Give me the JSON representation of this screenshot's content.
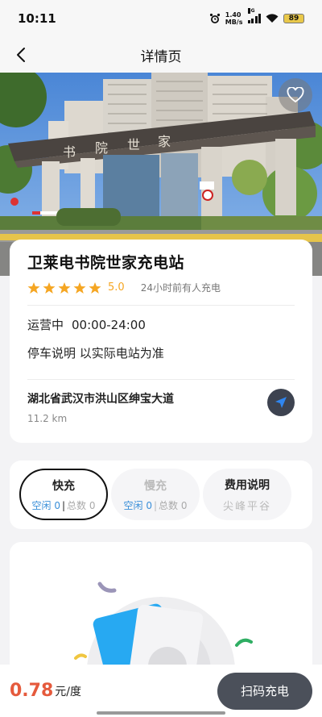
{
  "status_bar": {
    "time": "10:11",
    "net_speed_value": "1.40",
    "net_speed_unit": "MB/s",
    "network": "5G",
    "battery": "89"
  },
  "header": {
    "title": "详情页",
    "back_icon": "chevron-left-icon"
  },
  "hero": {
    "sign_text": "书院世家",
    "favorite_icon": "heart-outline-icon"
  },
  "station": {
    "name": "卫莱电书院世家充电站",
    "stars": 5,
    "rating": "5.0",
    "recent_activity": "24小时前有人充电",
    "status": "运营中",
    "hours": "00:00-24:00",
    "parking_note": "停车说明 以实际电站为准",
    "address": "湖北省武汉市洪山区绅宝大道",
    "distance": "11.2 km",
    "nav_icon": "navigation-arrow-icon"
  },
  "charge_types": [
    {
      "label": "快充",
      "free_label": "空闲 0",
      "total_label": "总数 0"
    },
    {
      "label": "慢充",
      "free_label": "空闲 0",
      "total_label": "总数 0"
    },
    {
      "label": "费用说明",
      "sub": "尖峰平谷"
    }
  ],
  "footer": {
    "price": "0.78",
    "price_unit": "元/度",
    "scan_label": "扫码充电"
  },
  "colors": {
    "accent_orange": "#e55a3c",
    "star": "#f5a623",
    "free_blue": "#3a8fd9",
    "button_dark": "#4b505a"
  }
}
